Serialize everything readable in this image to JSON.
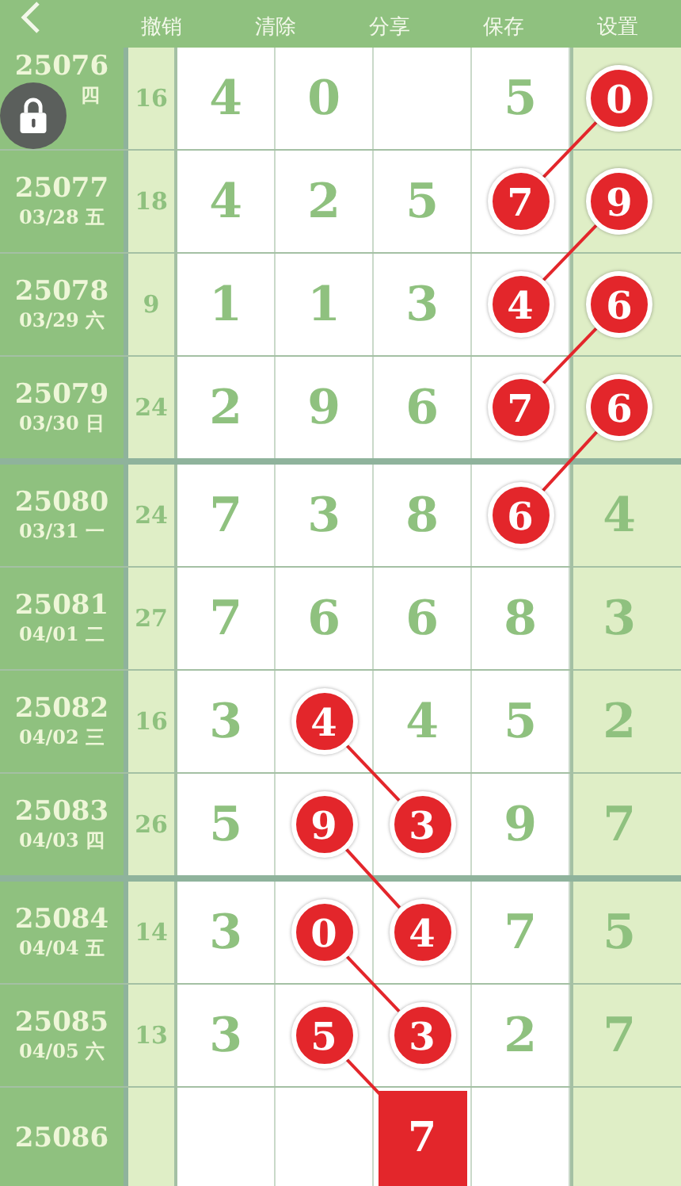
{
  "header": {
    "actions": [
      "撤销",
      "清除",
      "分享",
      "保存",
      "设置"
    ]
  },
  "rows": [
    {
      "period": "25076",
      "date": "四",
      "sum": "16",
      "group_end": false,
      "cells": [
        {
          "value": "4",
          "kind": "digit"
        },
        {
          "value": "0",
          "kind": "digit"
        },
        {
          "kind": "blank"
        },
        {
          "value": "5",
          "kind": "digit"
        },
        {
          "value": "0",
          "kind": "ball",
          "linked": true
        }
      ]
    },
    {
      "period": "25077",
      "date": "03/28 五",
      "sum": "18",
      "group_end": false,
      "cells": [
        {
          "value": "4",
          "kind": "digit"
        },
        {
          "value": "2",
          "kind": "digit"
        },
        {
          "value": "5",
          "kind": "digit"
        },
        {
          "value": "7",
          "kind": "ball",
          "linked": false
        },
        {
          "value": "9",
          "kind": "ball",
          "linked": true
        }
      ]
    },
    {
      "period": "25078",
      "date": "03/29 六",
      "sum": "9",
      "group_end": false,
      "cells": [
        {
          "value": "1",
          "kind": "digit"
        },
        {
          "value": "1",
          "kind": "digit"
        },
        {
          "value": "3",
          "kind": "digit"
        },
        {
          "value": "4",
          "kind": "ball",
          "linked": false
        },
        {
          "value": "6",
          "kind": "ball",
          "linked": true
        }
      ]
    },
    {
      "period": "25079",
      "date": "03/30 日",
      "sum": "24",
      "group_end": true,
      "cells": [
        {
          "value": "2",
          "kind": "digit"
        },
        {
          "value": "9",
          "kind": "digit"
        },
        {
          "value": "6",
          "kind": "digit"
        },
        {
          "value": "7",
          "kind": "ball",
          "linked": false
        },
        {
          "value": "6",
          "kind": "ball",
          "linked": true
        }
      ]
    },
    {
      "period": "25080",
      "date": "03/31 一",
      "sum": "24",
      "group_end": false,
      "cells": [
        {
          "value": "7",
          "kind": "digit"
        },
        {
          "value": "3",
          "kind": "digit"
        },
        {
          "value": "8",
          "kind": "digit"
        },
        {
          "value": "6",
          "kind": "ball",
          "linked": false
        },
        {
          "value": "4",
          "kind": "digit"
        }
      ]
    },
    {
      "period": "25081",
      "date": "04/01 二",
      "sum": "27",
      "group_end": false,
      "cells": [
        {
          "value": "7",
          "kind": "digit"
        },
        {
          "value": "6",
          "kind": "digit"
        },
        {
          "value": "6",
          "kind": "digit"
        },
        {
          "value": "8",
          "kind": "digit"
        },
        {
          "value": "3",
          "kind": "digit"
        }
      ]
    },
    {
      "period": "25082",
      "date": "04/02 三",
      "sum": "16",
      "group_end": false,
      "cells": [
        {
          "value": "3",
          "kind": "digit"
        },
        {
          "value": "4",
          "kind": "ball",
          "linked": true
        },
        {
          "value": "4",
          "kind": "digit"
        },
        {
          "value": "5",
          "kind": "digit"
        },
        {
          "value": "2",
          "kind": "digit"
        }
      ]
    },
    {
      "period": "25083",
      "date": "04/03 四",
      "sum": "26",
      "group_end": true,
      "cells": [
        {
          "value": "5",
          "kind": "digit"
        },
        {
          "value": "9",
          "kind": "ball",
          "linked": true
        },
        {
          "value": "3",
          "kind": "ball",
          "linked": false
        },
        {
          "value": "9",
          "kind": "digit"
        },
        {
          "value": "7",
          "kind": "digit"
        }
      ]
    },
    {
      "period": "25084",
      "date": "04/04 五",
      "sum": "14",
      "group_end": false,
      "cells": [
        {
          "value": "3",
          "kind": "digit"
        },
        {
          "value": "0",
          "kind": "ball",
          "linked": true
        },
        {
          "value": "4",
          "kind": "ball",
          "linked": false
        },
        {
          "value": "7",
          "kind": "digit"
        },
        {
          "value": "5",
          "kind": "digit"
        }
      ]
    },
    {
      "period": "25085",
      "date": "04/05 六",
      "sum": "13",
      "group_end": false,
      "cells": [
        {
          "value": "3",
          "kind": "digit"
        },
        {
          "value": "5",
          "kind": "ball",
          "linked": true
        },
        {
          "value": "3",
          "kind": "ball",
          "linked": false
        },
        {
          "value": "2",
          "kind": "digit"
        },
        {
          "value": "7",
          "kind": "digit"
        }
      ]
    },
    {
      "period": "25086",
      "group_end": false,
      "cells": [
        {
          "kind": "blank"
        },
        {
          "kind": "blank"
        },
        {
          "value": "7",
          "kind": "square"
        },
        {
          "kind": "blank"
        },
        {
          "kind": "blank"
        }
      ]
    }
  ]
}
